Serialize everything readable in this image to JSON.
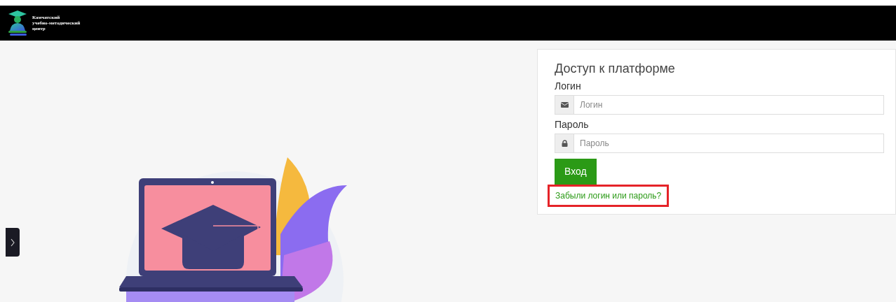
{
  "header": {
    "logo_lines": [
      "Камчатский",
      "учебно-методический",
      "центр"
    ]
  },
  "login": {
    "title": "Доступ к платформе",
    "fields": [
      {
        "label": "Логин",
        "placeholder": "Логин",
        "kind": "email"
      },
      {
        "label": "Пароль",
        "placeholder": "Пароль",
        "kind": "password"
      }
    ],
    "submit": "Вход",
    "forgot_link": {
      "text": "Забыли логин или пароль?",
      "highlighted": true
    }
  }
}
